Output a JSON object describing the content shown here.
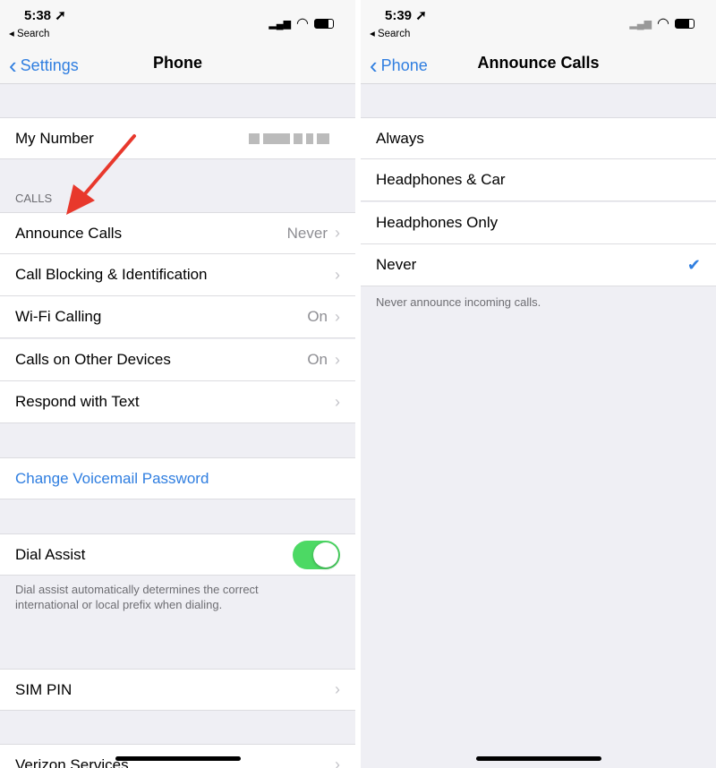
{
  "left": {
    "time": "5:38",
    "back_app": "Search",
    "nav_back": "Settings",
    "title": "Phone",
    "my_number": "My Number",
    "calls_header": "CALLS",
    "rows": [
      {
        "label": "Announce Calls",
        "value": "Never"
      },
      {
        "label": "Call Blocking & Identification",
        "value": ""
      },
      {
        "label": "Wi-Fi Calling",
        "value": "On"
      },
      {
        "label": "Calls on Other Devices",
        "value": "On"
      },
      {
        "label": "Respond with Text",
        "value": ""
      }
    ],
    "voicemail": "Change Voicemail Password",
    "dial_assist": "Dial Assist",
    "dial_assist_on": true,
    "dial_assist_footer_1": "Dial assist automatically determines the correct",
    "dial_assist_footer_2": "international or local prefix when dialing.",
    "sim_pin": "SIM PIN",
    "verizon": "Verizon Services"
  },
  "right": {
    "time": "5:39",
    "back_app": "Search",
    "nav_back": "Phone",
    "title": "Announce Calls",
    "options": [
      "Always",
      "Headphones & Car",
      "Headphones Only",
      "Never"
    ],
    "selected": "Never",
    "footer": "Never announce incoming calls."
  },
  "colors": {
    "accent": "#2f7ee0",
    "toggle_on": "#4cd964",
    "arrow": "#e8382c"
  }
}
